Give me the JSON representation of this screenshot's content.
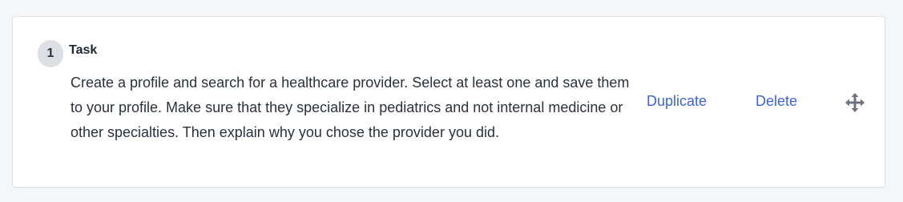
{
  "task": {
    "step_number": "1",
    "title": "Task",
    "description": "Create a profile and search for a healthcare provider. Select at least one and save them to your profile. Make sure that they specialize in pediatrics and not internal medicine or other specialties. Then explain why you chose the provider you did.",
    "actions": {
      "duplicate_label": "Duplicate",
      "delete_label": "Delete"
    },
    "icons": {
      "drag": "move-arrows-icon"
    }
  },
  "colors": {
    "accent_link": "#3d63dd",
    "badge_bg": "#dcdfe3",
    "text": "#2a313b"
  }
}
